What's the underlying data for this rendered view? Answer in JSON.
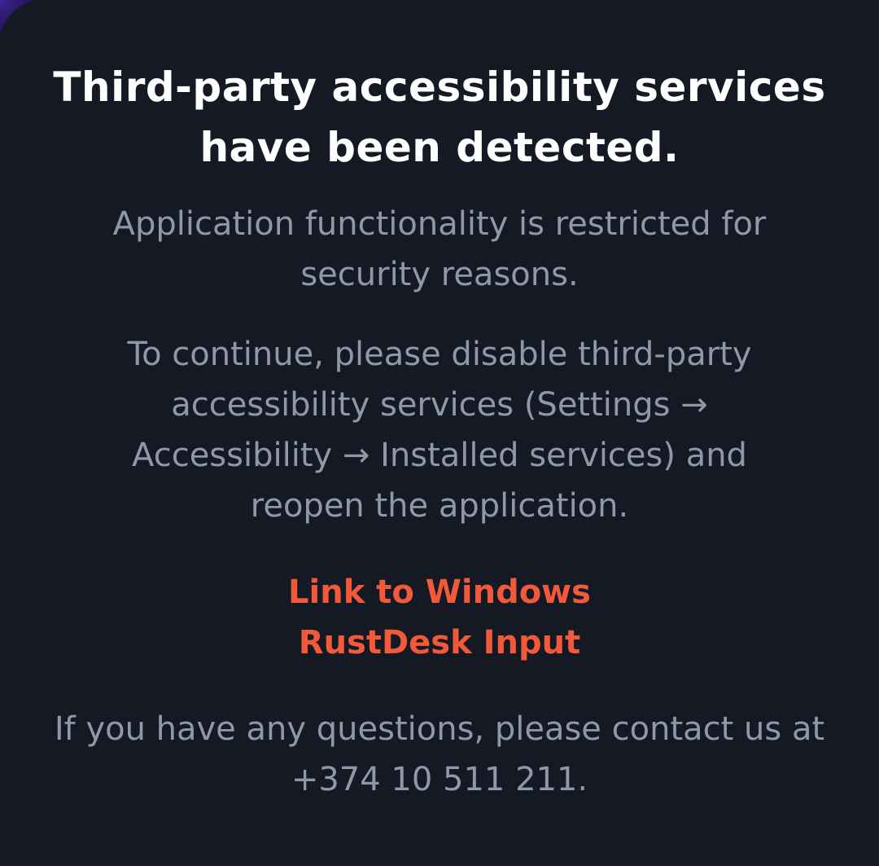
{
  "dialog": {
    "title": "Third-party accessibility services have been detected.",
    "restriction_text": "Application functionality is restricted for security reasons.",
    "instruction_text": "To continue, please disable third-party accessibility services (Settings → Accessibility → Installed services) and reopen the application.",
    "links": [
      {
        "label": "Link to Windows"
      },
      {
        "label": "RustDesk Input"
      }
    ],
    "contact_text": "If you have any questions, please contact us at +374 10 511 211."
  },
  "colors": {
    "background": "#141923",
    "title": "#ffffff",
    "body_text": "#8e98a8",
    "link": "#f0593a"
  }
}
